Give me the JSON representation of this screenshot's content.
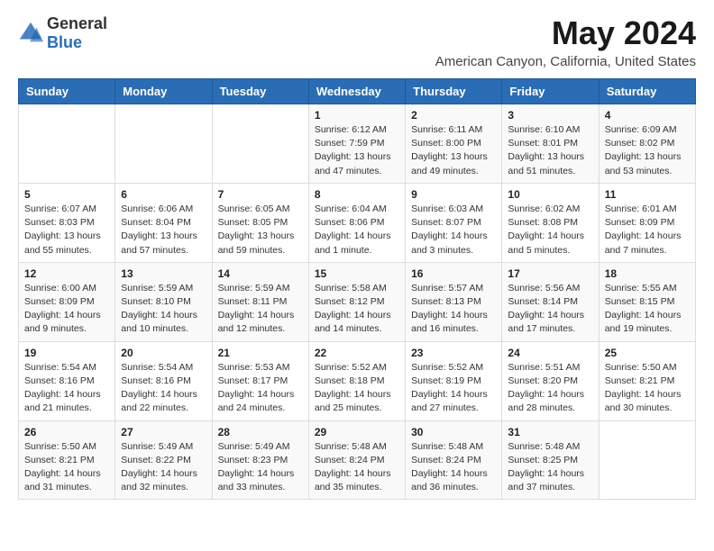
{
  "logo": {
    "general": "General",
    "blue": "Blue"
  },
  "header": {
    "month_year": "May 2024",
    "location": "American Canyon, California, United States"
  },
  "weekdays": [
    "Sunday",
    "Monday",
    "Tuesday",
    "Wednesday",
    "Thursday",
    "Friday",
    "Saturday"
  ],
  "weeks": [
    [
      {
        "day": "",
        "info": ""
      },
      {
        "day": "",
        "info": ""
      },
      {
        "day": "",
        "info": ""
      },
      {
        "day": "1",
        "info": "Sunrise: 6:12 AM\nSunset: 7:59 PM\nDaylight: 13 hours\nand 47 minutes."
      },
      {
        "day": "2",
        "info": "Sunrise: 6:11 AM\nSunset: 8:00 PM\nDaylight: 13 hours\nand 49 minutes."
      },
      {
        "day": "3",
        "info": "Sunrise: 6:10 AM\nSunset: 8:01 PM\nDaylight: 13 hours\nand 51 minutes."
      },
      {
        "day": "4",
        "info": "Sunrise: 6:09 AM\nSunset: 8:02 PM\nDaylight: 13 hours\nand 53 minutes."
      }
    ],
    [
      {
        "day": "5",
        "info": "Sunrise: 6:07 AM\nSunset: 8:03 PM\nDaylight: 13 hours\nand 55 minutes."
      },
      {
        "day": "6",
        "info": "Sunrise: 6:06 AM\nSunset: 8:04 PM\nDaylight: 13 hours\nand 57 minutes."
      },
      {
        "day": "7",
        "info": "Sunrise: 6:05 AM\nSunset: 8:05 PM\nDaylight: 13 hours\nand 59 minutes."
      },
      {
        "day": "8",
        "info": "Sunrise: 6:04 AM\nSunset: 8:06 PM\nDaylight: 14 hours\nand 1 minute."
      },
      {
        "day": "9",
        "info": "Sunrise: 6:03 AM\nSunset: 8:07 PM\nDaylight: 14 hours\nand 3 minutes."
      },
      {
        "day": "10",
        "info": "Sunrise: 6:02 AM\nSunset: 8:08 PM\nDaylight: 14 hours\nand 5 minutes."
      },
      {
        "day": "11",
        "info": "Sunrise: 6:01 AM\nSunset: 8:09 PM\nDaylight: 14 hours\nand 7 minutes."
      }
    ],
    [
      {
        "day": "12",
        "info": "Sunrise: 6:00 AM\nSunset: 8:09 PM\nDaylight: 14 hours\nand 9 minutes."
      },
      {
        "day": "13",
        "info": "Sunrise: 5:59 AM\nSunset: 8:10 PM\nDaylight: 14 hours\nand 10 minutes."
      },
      {
        "day": "14",
        "info": "Sunrise: 5:59 AM\nSunset: 8:11 PM\nDaylight: 14 hours\nand 12 minutes."
      },
      {
        "day": "15",
        "info": "Sunrise: 5:58 AM\nSunset: 8:12 PM\nDaylight: 14 hours\nand 14 minutes."
      },
      {
        "day": "16",
        "info": "Sunrise: 5:57 AM\nSunset: 8:13 PM\nDaylight: 14 hours\nand 16 minutes."
      },
      {
        "day": "17",
        "info": "Sunrise: 5:56 AM\nSunset: 8:14 PM\nDaylight: 14 hours\nand 17 minutes."
      },
      {
        "day": "18",
        "info": "Sunrise: 5:55 AM\nSunset: 8:15 PM\nDaylight: 14 hours\nand 19 minutes."
      }
    ],
    [
      {
        "day": "19",
        "info": "Sunrise: 5:54 AM\nSunset: 8:16 PM\nDaylight: 14 hours\nand 21 minutes."
      },
      {
        "day": "20",
        "info": "Sunrise: 5:54 AM\nSunset: 8:16 PM\nDaylight: 14 hours\nand 22 minutes."
      },
      {
        "day": "21",
        "info": "Sunrise: 5:53 AM\nSunset: 8:17 PM\nDaylight: 14 hours\nand 24 minutes."
      },
      {
        "day": "22",
        "info": "Sunrise: 5:52 AM\nSunset: 8:18 PM\nDaylight: 14 hours\nand 25 minutes."
      },
      {
        "day": "23",
        "info": "Sunrise: 5:52 AM\nSunset: 8:19 PM\nDaylight: 14 hours\nand 27 minutes."
      },
      {
        "day": "24",
        "info": "Sunrise: 5:51 AM\nSunset: 8:20 PM\nDaylight: 14 hours\nand 28 minutes."
      },
      {
        "day": "25",
        "info": "Sunrise: 5:50 AM\nSunset: 8:21 PM\nDaylight: 14 hours\nand 30 minutes."
      }
    ],
    [
      {
        "day": "26",
        "info": "Sunrise: 5:50 AM\nSunset: 8:21 PM\nDaylight: 14 hours\nand 31 minutes."
      },
      {
        "day": "27",
        "info": "Sunrise: 5:49 AM\nSunset: 8:22 PM\nDaylight: 14 hours\nand 32 minutes."
      },
      {
        "day": "28",
        "info": "Sunrise: 5:49 AM\nSunset: 8:23 PM\nDaylight: 14 hours\nand 33 minutes."
      },
      {
        "day": "29",
        "info": "Sunrise: 5:48 AM\nSunset: 8:24 PM\nDaylight: 14 hours\nand 35 minutes."
      },
      {
        "day": "30",
        "info": "Sunrise: 5:48 AM\nSunset: 8:24 PM\nDaylight: 14 hours\nand 36 minutes."
      },
      {
        "day": "31",
        "info": "Sunrise: 5:48 AM\nSunset: 8:25 PM\nDaylight: 14 hours\nand 37 minutes."
      },
      {
        "day": "",
        "info": ""
      }
    ]
  ]
}
